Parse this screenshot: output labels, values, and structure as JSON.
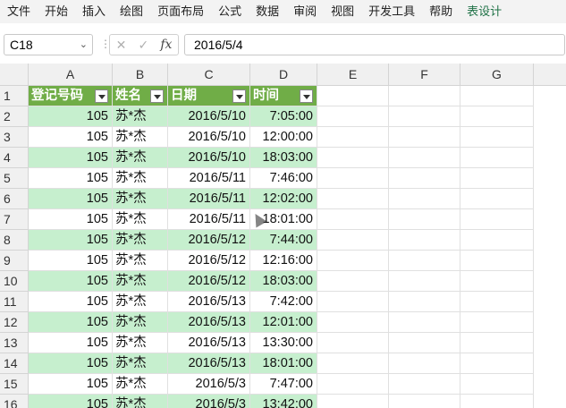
{
  "menu": [
    "文件",
    "开始",
    "插入",
    "绘图",
    "页面布局",
    "公式",
    "数据",
    "审阅",
    "视图",
    "开发工具",
    "帮助",
    "表设计"
  ],
  "formula_bar": {
    "name_box": "C18",
    "cancel_icon": "✕",
    "enter_icon": "✓",
    "fx_label": "fx",
    "value": "2016/5/4"
  },
  "columns": [
    "A",
    "B",
    "C",
    "D",
    "E",
    "F",
    "G"
  ],
  "table_headers": [
    "登记号码",
    "姓名",
    "日期",
    "时间"
  ],
  "rows": [
    {
      "n": "1"
    },
    {
      "n": "2",
      "a": "105",
      "b": "苏*杰",
      "c": "2016/5/10",
      "d": "7:05:00"
    },
    {
      "n": "3",
      "a": "105",
      "b": "苏*杰",
      "c": "2016/5/10",
      "d": "12:00:00"
    },
    {
      "n": "4",
      "a": "105",
      "b": "苏*杰",
      "c": "2016/5/10",
      "d": "18:03:00"
    },
    {
      "n": "5",
      "a": "105",
      "b": "苏*杰",
      "c": "2016/5/11",
      "d": "7:46:00"
    },
    {
      "n": "6",
      "a": "105",
      "b": "苏*杰",
      "c": "2016/5/11",
      "d": "12:02:00"
    },
    {
      "n": "7",
      "a": "105",
      "b": "苏*杰",
      "c": "2016/5/11",
      "d": "18:01:00"
    },
    {
      "n": "8",
      "a": "105",
      "b": "苏*杰",
      "c": "2016/5/12",
      "d": "7:44:00"
    },
    {
      "n": "9",
      "a": "105",
      "b": "苏*杰",
      "c": "2016/5/12",
      "d": "12:16:00"
    },
    {
      "n": "10",
      "a": "105",
      "b": "苏*杰",
      "c": "2016/5/12",
      "d": "18:03:00"
    },
    {
      "n": "11",
      "a": "105",
      "b": "苏*杰",
      "c": "2016/5/13",
      "d": "7:42:00"
    },
    {
      "n": "12",
      "a": "105",
      "b": "苏*杰",
      "c": "2016/5/13",
      "d": "12:01:00"
    },
    {
      "n": "13",
      "a": "105",
      "b": "苏*杰",
      "c": "2016/5/13",
      "d": "13:30:00"
    },
    {
      "n": "14",
      "a": "105",
      "b": "苏*杰",
      "c": "2016/5/13",
      "d": "18:01:00"
    },
    {
      "n": "15",
      "a": "105",
      "b": "苏*杰",
      "c": "2016/5/3",
      "d": "7:47:00"
    },
    {
      "n": "16",
      "a": "105",
      "b": "苏*杰",
      "c": "2016/5/3",
      "d": "13:42:00"
    }
  ],
  "colors": {
    "table_header": "#70ad47",
    "band": "#c6efce",
    "active_tab": "#1e7145"
  }
}
